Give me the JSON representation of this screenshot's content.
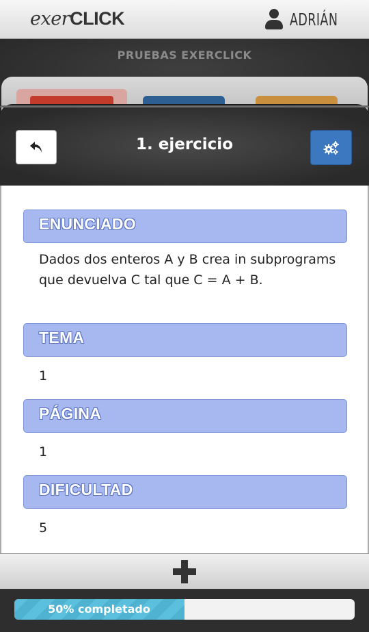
{
  "app": {
    "logo_prefix": "exer",
    "logo_main": "CLICK",
    "user_name": "ADRIÁN"
  },
  "banner": {
    "title": "PRUEBAS EXERCLICK"
  },
  "card": {
    "title": "1. ejercicio",
    "sections": [
      {
        "header": "ENUNCIADO",
        "value": "Dados dos enteros A y B crea in subprograms que devuelva C tal que C = A + B."
      },
      {
        "header": "TEMA",
        "value": "1"
      },
      {
        "header": "PÁGINA",
        "value": "1"
      },
      {
        "header": "DIFICULTAD",
        "value": "5"
      }
    ]
  },
  "toolbar": {
    "back_icon": "undo-arrow-icon",
    "settings_icon": "gears-icon",
    "add_icon": "plus-icon"
  },
  "progress": {
    "label": "50% completado",
    "fraction": 0.5
  },
  "colors": {
    "section_header_bg": "#a7b8f0",
    "settings_button": "#3b78c0",
    "progress_fill": "#5bc0de"
  }
}
